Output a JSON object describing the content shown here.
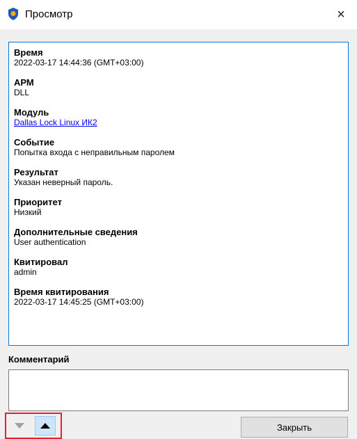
{
  "window": {
    "title": "Просмотр",
    "close_glyph": "×"
  },
  "fields": [
    {
      "label": "Время",
      "value": "2022-03-17 14:44:36 (GMT+03:00)"
    },
    {
      "label": "АРМ",
      "value": "DLL"
    },
    {
      "label": "Модуль",
      "value": "Dallas Lock Linux ИК2"
    },
    {
      "label": "Событие",
      "value": "Попытка входа с неправильным паролем"
    },
    {
      "label": "Результат",
      "value": "Указан неверный пароль."
    },
    {
      "label": "Приоритет",
      "value": "Низкий"
    },
    {
      "label": "Дополнительные сведения",
      "value": "User authentication"
    },
    {
      "label": "Квитировал",
      "value": "admin"
    },
    {
      "label": "Время квитирования",
      "value": "2022-03-17 14:45:25 (GMT+03:00)"
    }
  ],
  "comment": {
    "label": "Комментарий",
    "value": ""
  },
  "buttons": {
    "close_label": "Закрыть"
  },
  "colors": {
    "focus_border": "#0078d7",
    "link": "#0000ee",
    "highlight_frame": "#e51f2b",
    "selected_button": "#cde5f7"
  },
  "icons": {
    "app": "shield-icon",
    "prev": "triangle-down-icon",
    "next": "triangle-up-icon",
    "close": "close-icon"
  }
}
